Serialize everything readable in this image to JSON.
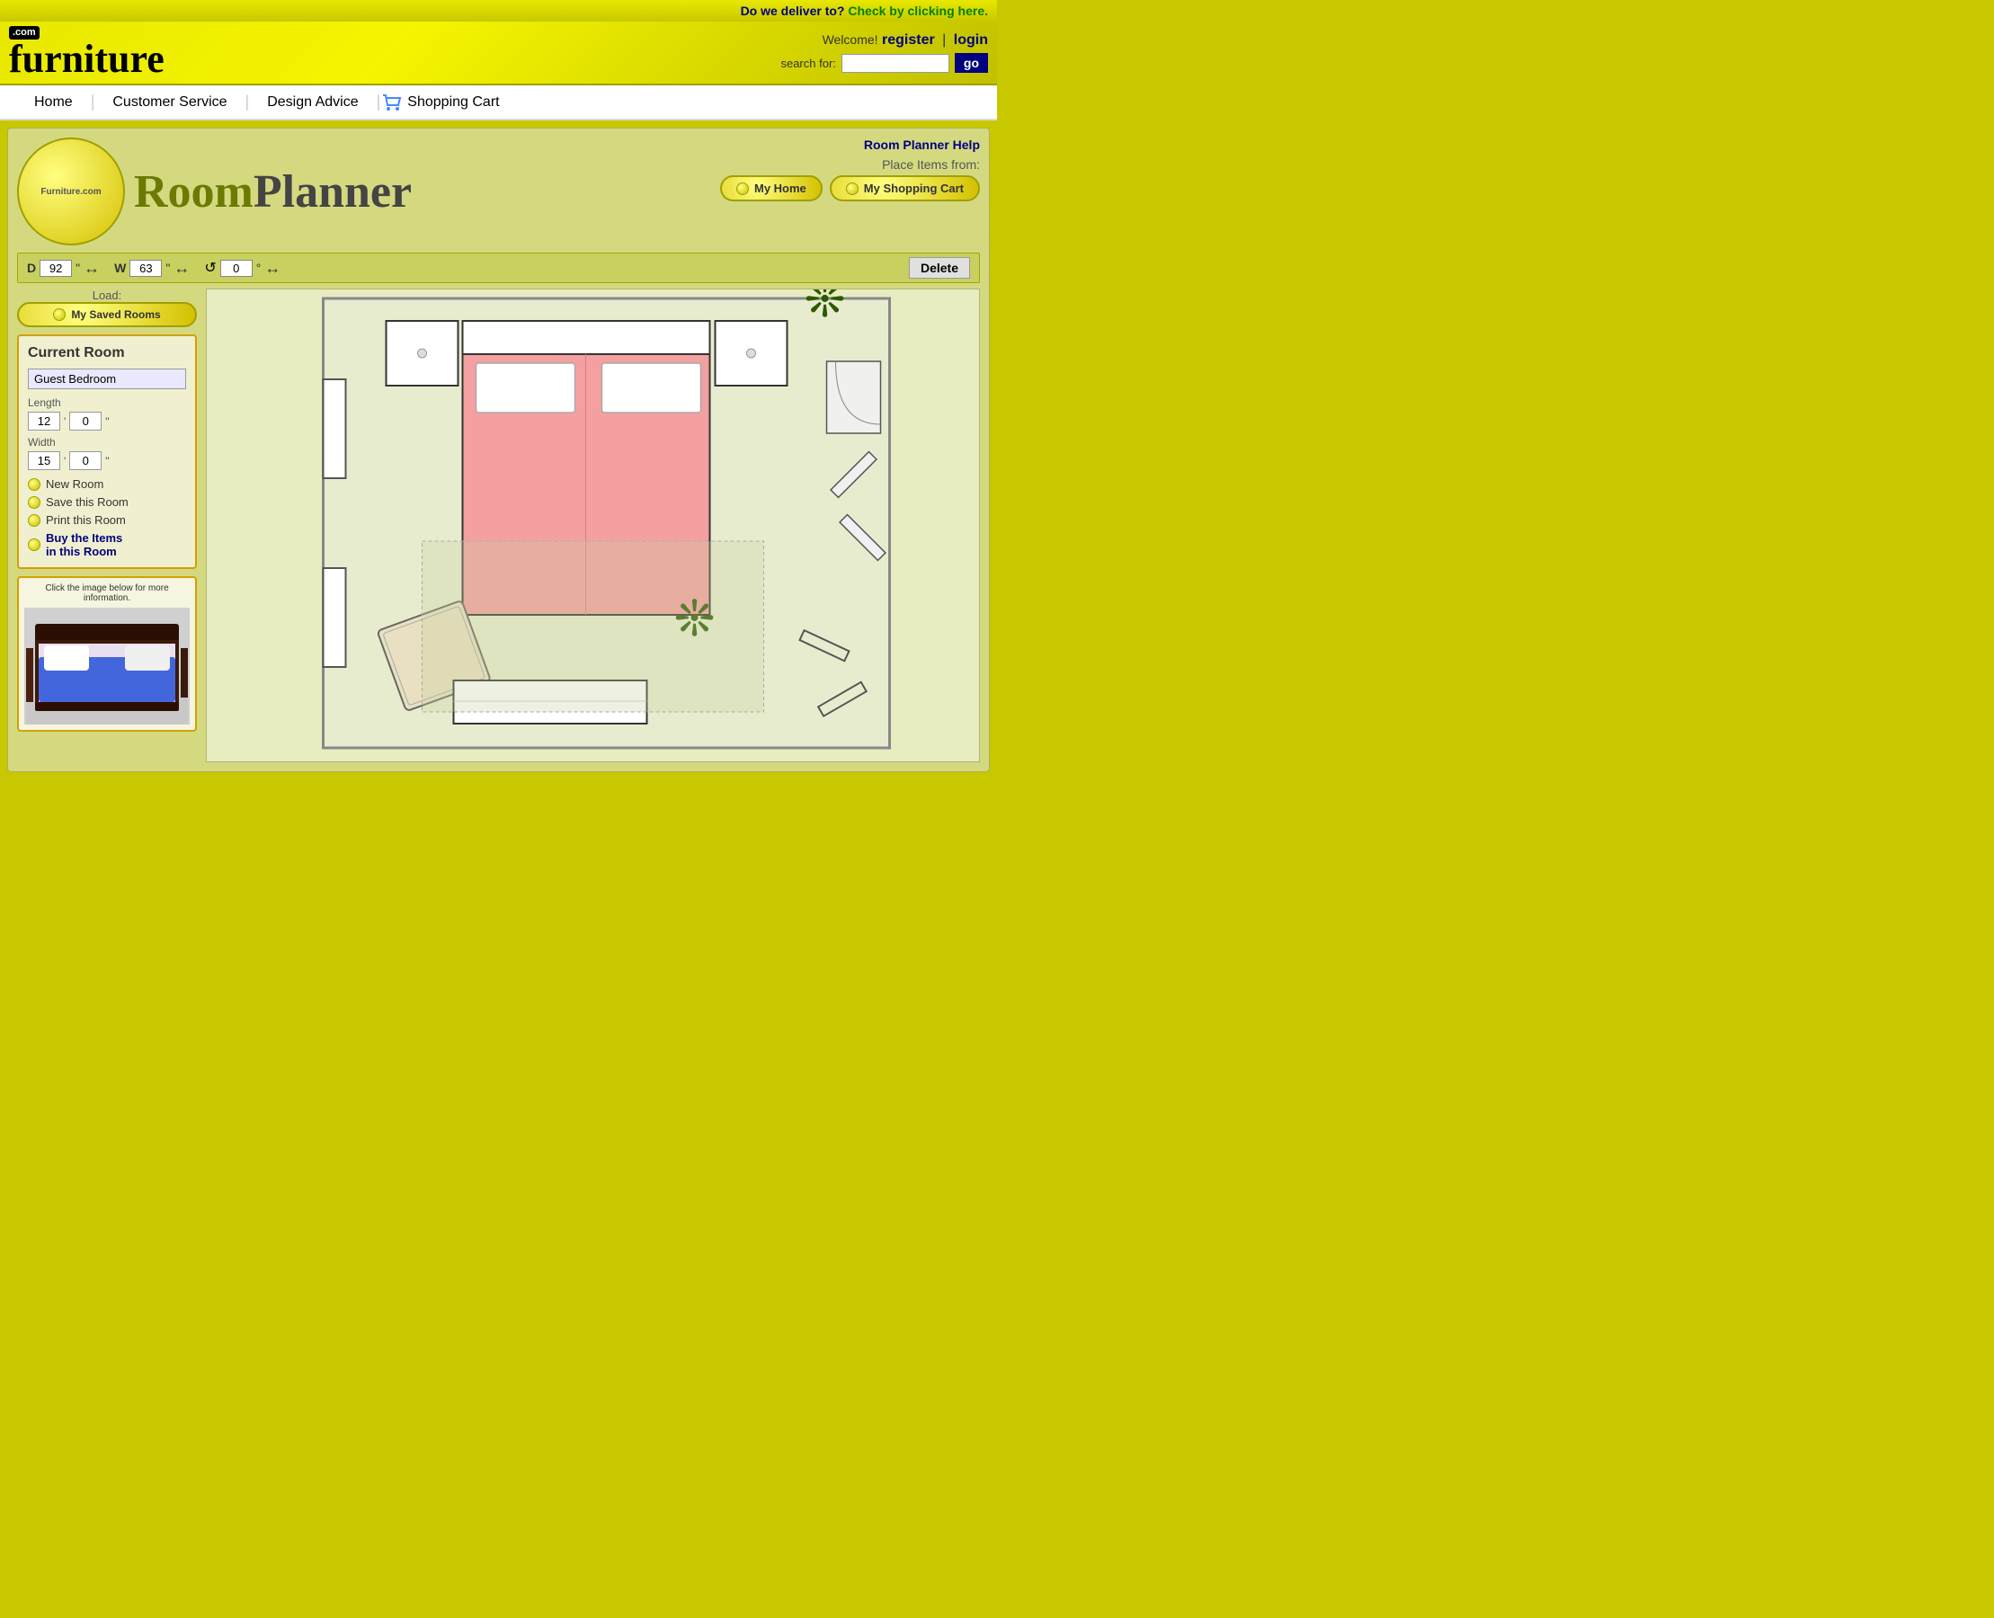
{
  "topbar": {
    "delivery_question": "Do we deliver to?",
    "delivery_link": "Check by clicking here."
  },
  "header": {
    "logo_com": ".com",
    "logo_name": "furniture",
    "welcome": "Welcome!",
    "register": "register",
    "separator": "|",
    "login": "login",
    "search_label": "search for:",
    "search_placeholder": "",
    "go_label": "go"
  },
  "nav": {
    "home": "Home",
    "customer_service": "Customer Service",
    "design_advice": "Design Advice",
    "shopping_cart": "Shopping Cart"
  },
  "room_planner": {
    "site_name": "Furniture.com",
    "title_room": "Room",
    "title_planner": "Planner",
    "help_link": "Room Planner Help",
    "place_items_label": "Place Items from:",
    "my_home_btn": "My Home",
    "my_cart_btn": "My Shopping Cart",
    "load_label": "Load:",
    "my_saved_rooms": "My Saved Rooms",
    "current_room_title": "Current Room",
    "room_name": "Guest Bedroom",
    "length_label": "Length",
    "length_ft": "12",
    "length_in": "0",
    "width_label": "Width",
    "width_ft": "15",
    "width_in": "0",
    "new_room": "New Room",
    "save_room": "Save this Room",
    "print_room": "Print this Room",
    "buy_items": "Buy the Items\nin this Room",
    "info_title": "Click the image below for more information.",
    "controls": {
      "d_label": "D",
      "d_value": "92",
      "d_unit": "\"",
      "w_label": "W",
      "w_value": "63",
      "w_unit": "\"",
      "rotate_value": "0",
      "rotate_unit": "°",
      "delete_label": "Delete"
    }
  }
}
